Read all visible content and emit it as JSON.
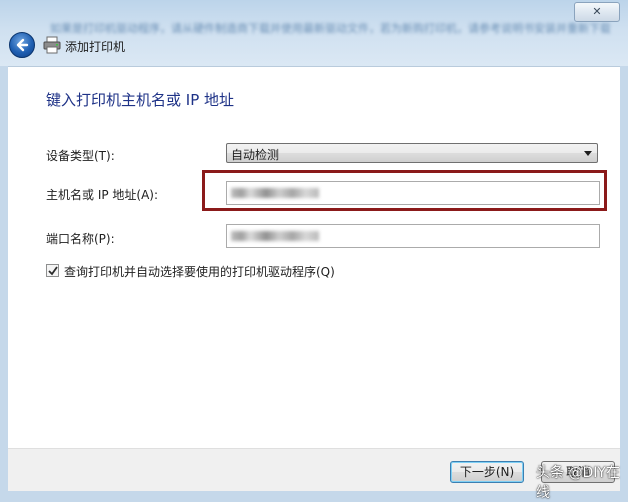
{
  "window": {
    "title": "添加打印机",
    "close_label": "✕",
    "glass_text": "如果是打印机驱动程序，请从硬件制造商下载并使用最新驱动文件，若为新购打印机，请参考说明书安装并重新下载。"
  },
  "page": {
    "heading": "键入打印机主机名或 IP 地址",
    "device_type_label": "设备类型(T):",
    "device_type_value": "自动检测",
    "host_label": "主机名或 IP 地址(A):",
    "port_label": "端口名称(P):",
    "query_checkbox_label": "查询打印机并自动选择要使用的打印机驱动程序(Q)",
    "query_checkbox_checked": true
  },
  "footer": {
    "next_label": "下一步(N)",
    "cancel_label": "取消"
  },
  "watermark": "头条 @DIY在线",
  "colors": {
    "highlight": "#8b1a1a",
    "heading": "#1e3287"
  }
}
